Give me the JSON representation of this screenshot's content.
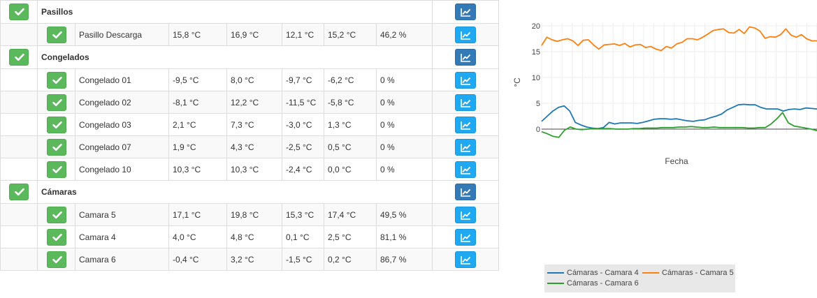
{
  "groups": [
    {
      "name": "Pasillos",
      "rows": [
        {
          "name": "Pasillo Descarga",
          "v1": "15,8 °C",
          "v2": "16,9 °C",
          "v3": "12,1 °C",
          "v4": "15,2 °C",
          "v5": "46,2 %"
        }
      ]
    },
    {
      "name": "Congelados",
      "rows": [
        {
          "name": "Congelado 01",
          "v1": "-9,5 °C",
          "v2": "8,0 °C",
          "v3": "-9,7 °C",
          "v4": "-6,2 °C",
          "v5": "0 %"
        },
        {
          "name": "Congelado 02",
          "v1": "-8,1 °C",
          "v2": "12,2 °C",
          "v3": "-11,5 °C",
          "v4": "-5,8 °C",
          "v5": "0 %"
        },
        {
          "name": "Congelado 03",
          "v1": "2,1 °C",
          "v2": "7,3 °C",
          "v3": "-3,0 °C",
          "v4": "1,3 °C",
          "v5": "0 %"
        },
        {
          "name": "Congelado 07",
          "v1": "1,9 °C",
          "v2": "4,3 °C",
          "v3": "-2,5 °C",
          "v4": "0,5 °C",
          "v5": "0 %"
        },
        {
          "name": "Congelado 10",
          "v1": "10,3 °C",
          "v2": "10,3 °C",
          "v3": "-2,4 °C",
          "v4": "0,0 °C",
          "v5": "0 %"
        }
      ]
    },
    {
      "name": "Cámaras",
      "rows": [
        {
          "name": "Camara 5",
          "v1": "17,1 °C",
          "v2": "19,8 °C",
          "v3": "15,3 °C",
          "v4": "17,4 °C",
          "v5": "49,5 %"
        },
        {
          "name": "Camara 4",
          "v1": "4,0 °C",
          "v2": "4,8 °C",
          "v3": "0,1 °C",
          "v4": "2,5 °C",
          "v5": "81,1 %"
        },
        {
          "name": "Camara 6",
          "v1": "-0,4 °C",
          "v2": "3,2 °C",
          "v3": "-1,5 °C",
          "v4": "0,2 °C",
          "v5": "86,7 %"
        }
      ]
    }
  ],
  "icons": {
    "ok": "check-icon",
    "chart": "line-chart-icon"
  },
  "colors": {
    "ok_button": "#5cb85c",
    "group_chart_button": "#337ab7",
    "row_chart_button": "#1ea9f2"
  },
  "chart_data": {
    "type": "line",
    "title": "",
    "xlabel": "Fecha",
    "ylabel": "°C",
    "ylim": [
      -0.5,
      20
    ],
    "yticks": [
      0,
      5,
      10,
      15,
      20
    ],
    "grid": true,
    "legend_placement": "bottom",
    "series": [
      {
        "name": "Cámaras - Camara 4",
        "color": "#1f77b4",
        "values": [
          1.5,
          2.5,
          3.5,
          4.2,
          4.5,
          3.5,
          1.3,
          0.8,
          0.4,
          0.2,
          0.1,
          0.3,
          1.3,
          1.0,
          1.2,
          1.2,
          1.2,
          1.1,
          1.3,
          1.6,
          1.9,
          2.0,
          2.0,
          1.9,
          2.0,
          1.8,
          1.6,
          1.5,
          1.7,
          1.8,
          2.2,
          2.5,
          2.9,
          3.7,
          4.2,
          4.7,
          4.8,
          4.7,
          4.7,
          4.2,
          3.9,
          3.9,
          3.9,
          3.5,
          3.8,
          3.9,
          3.8,
          4.1,
          4.0,
          3.9
        ]
      },
      {
        "name": "Cámaras - Camara 5",
        "color": "#ff7f0e",
        "values": [
          16.2,
          17.8,
          17.3,
          17.0,
          17.3,
          17.5,
          17.1,
          16.2,
          17.2,
          17.3,
          16.3,
          15.5,
          16.3,
          16.4,
          16.5,
          16.2,
          16.6,
          15.9,
          16.3,
          16.4,
          15.8,
          16.0,
          15.5,
          15.2,
          16.0,
          15.7,
          16.5,
          16.8,
          17.5,
          17.5,
          17.3,
          17.8,
          18.4,
          19.1,
          19.3,
          19.4,
          18.7,
          18.6,
          19.3,
          18.5,
          19.8,
          19.6,
          19.0,
          17.6,
          17.9,
          17.8,
          18.3,
          19.4,
          18.2,
          17.8,
          18.3,
          17.5,
          17.1,
          17.1
        ]
      },
      {
        "name": "Cámaras - Camara 6",
        "color": "#2ca02c",
        "values": [
          -0.5,
          -0.9,
          -1.4,
          -1.6,
          -0.2,
          0.4,
          0.0,
          -0.1,
          0.0,
          0.1,
          0.1,
          0.1,
          0.1,
          0.0,
          0.0,
          0.0,
          0.1,
          0.1,
          0.2,
          0.2,
          0.2,
          0.3,
          0.3,
          0.3,
          0.4,
          0.4,
          0.5,
          0.4,
          0.3,
          0.3,
          0.4,
          0.3,
          0.3,
          0.3,
          0.3,
          0.3,
          0.2,
          0.2,
          0.3,
          0.3,
          1.0,
          2.0,
          3.2,
          1.2,
          0.6,
          0.4,
          0.2,
          0.0,
          -0.3
        ]
      }
    ]
  }
}
